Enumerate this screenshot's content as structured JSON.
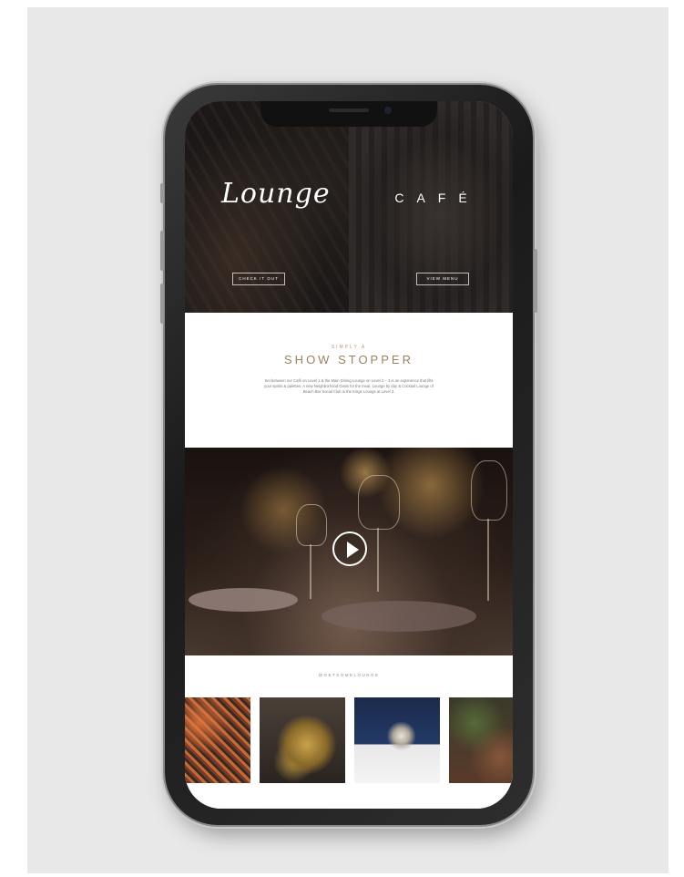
{
  "hero": {
    "lounge": {
      "title": "Lounge",
      "button_label": "CHECK IT OUT"
    },
    "cafe": {
      "title": "CAFÉ",
      "button_label": "VIEW MENU"
    }
  },
  "intro": {
    "kicker": "SIMPLY A",
    "headline": "SHOW STOPPER",
    "body": "Set between our Café on Level 1 & the Main Dining Lounge on Level 2 – 3 is an experience that lifts your spirits & palettes. A new Neighborhood Oasis for the meal, Lounge by day & Cocktail Lounge of Beach Bar Social Club in the Kings Lounge at Level 3."
  },
  "video": {
    "play_icon": "play-icon"
  },
  "instagram": {
    "handle": "@GETSOMELOUNGE",
    "thumbnails": [
      "lights-thumbnail",
      "golden-teapot-thumbnail",
      "coffee-cup-thumbnail",
      "lounge-interior-thumbnail"
    ]
  }
}
